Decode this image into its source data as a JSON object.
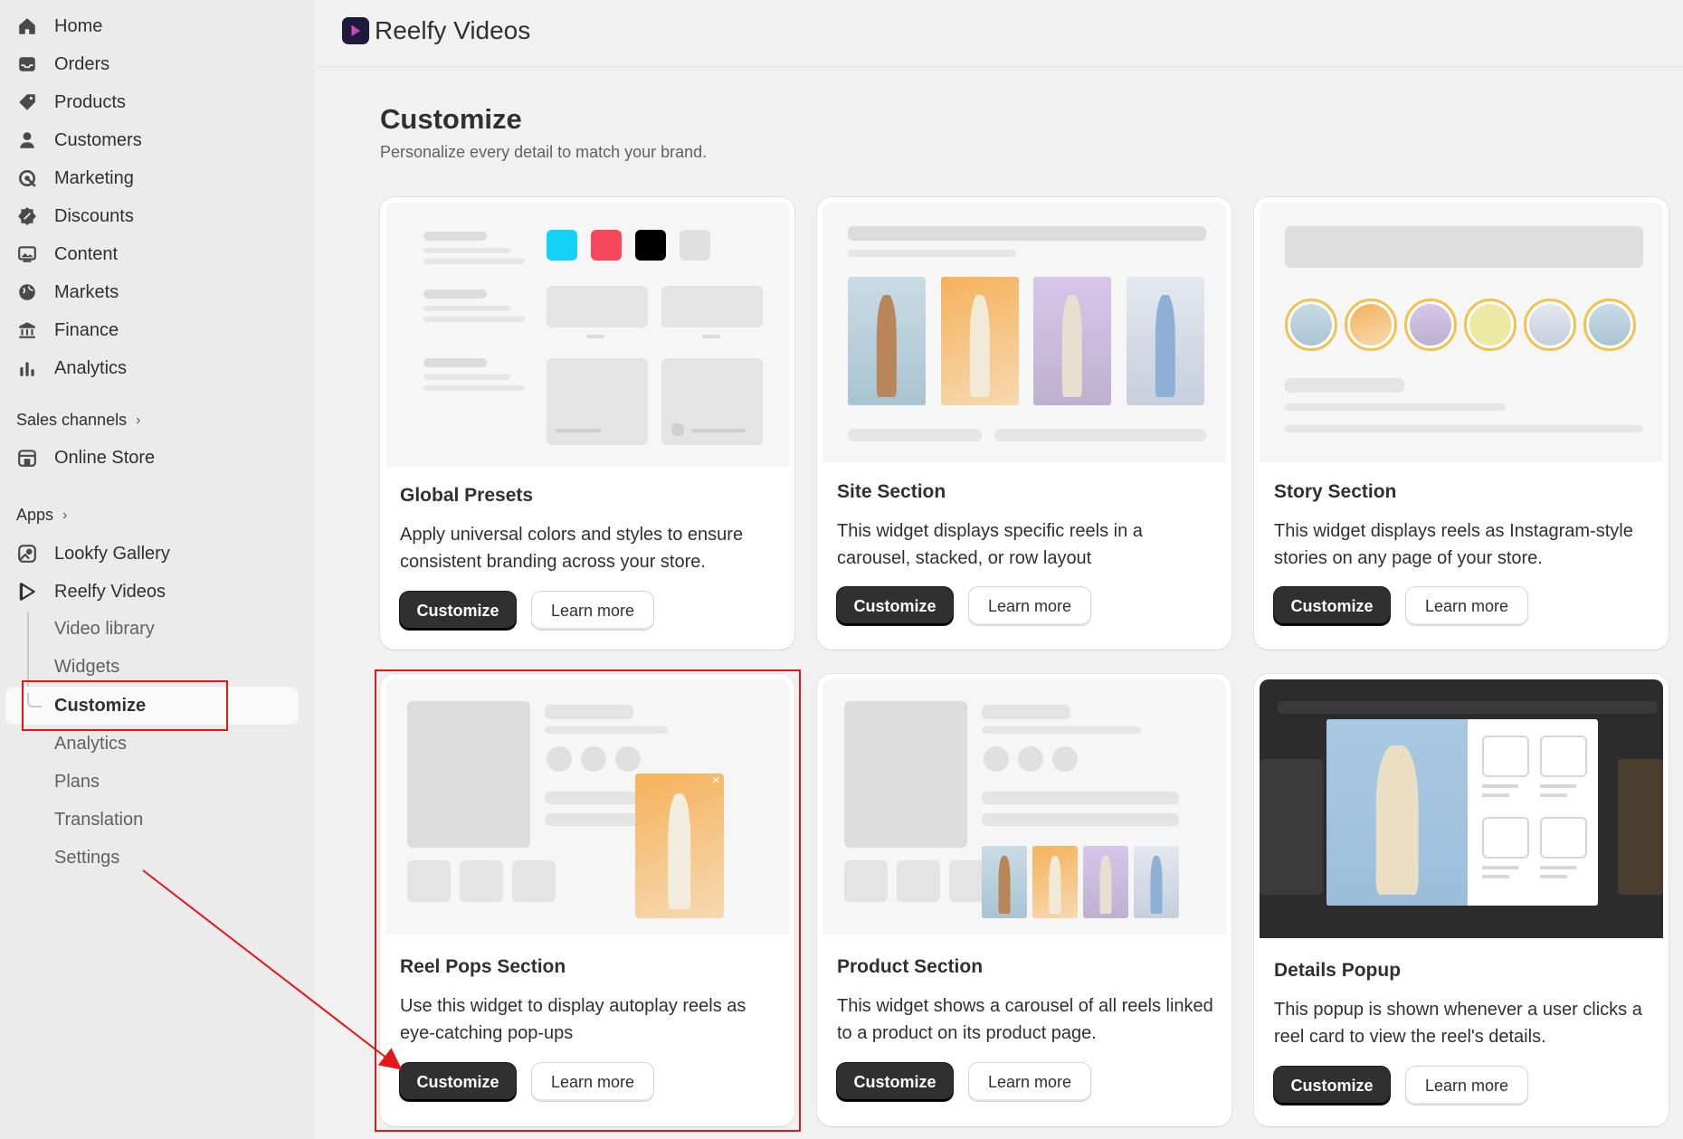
{
  "sidebar": {
    "nav": [
      {
        "label": "Home",
        "icon": "home-icon"
      },
      {
        "label": "Orders",
        "icon": "inbox-icon"
      },
      {
        "label": "Products",
        "icon": "tag-icon"
      },
      {
        "label": "Customers",
        "icon": "person-icon"
      },
      {
        "label": "Marketing",
        "icon": "target-icon"
      },
      {
        "label": "Discounts",
        "icon": "discount-icon"
      },
      {
        "label": "Content",
        "icon": "image-icon"
      },
      {
        "label": "Markets",
        "icon": "globe-icon"
      },
      {
        "label": "Finance",
        "icon": "bank-icon"
      },
      {
        "label": "Analytics",
        "icon": "chart-bars-icon"
      }
    ],
    "sales_channels_label": "Sales channels",
    "online_store_label": "Online Store",
    "apps_label": "Apps",
    "apps": [
      {
        "label": "Lookfy Gallery"
      },
      {
        "label": "Reelfy Videos"
      }
    ],
    "reelfy_sub": [
      "Video library",
      "Widgets",
      "Customize",
      "Analytics",
      "Plans",
      "Translation",
      "Settings"
    ]
  },
  "header": {
    "app_title": "Reelfy Videos"
  },
  "page": {
    "title": "Customize",
    "subtitle": "Personalize every detail to match your brand."
  },
  "cards": [
    {
      "title": "Global Presets",
      "desc": "Apply universal colors and styles to ensure consistent branding across your store.",
      "primary": "Customize",
      "secondary": "Learn more"
    },
    {
      "title": "Site Section",
      "desc": "This widget displays specific reels in a carousel, stacked, or row layout",
      "primary": "Customize",
      "secondary": "Learn more"
    },
    {
      "title": "Story Section",
      "desc": "This widget displays reels as Instagram-style stories on any page of your store.",
      "primary": "Customize",
      "secondary": "Learn more"
    },
    {
      "title": "Reel Pops Section",
      "desc": "Use this widget to display autoplay reels as eye-catching pop-ups",
      "primary": "Customize",
      "secondary": "Learn more"
    },
    {
      "title": "Product Section",
      "desc": "This widget shows a carousel of all reels linked to a product on its product page.",
      "primary": "Customize",
      "secondary": "Learn more"
    },
    {
      "title": "Details Popup",
      "desc": "This popup is shown whenever a user clicks a reel card to view the reel's details.",
      "primary": "Customize",
      "secondary": "Learn more"
    }
  ],
  "preset_colors": [
    "#14d2f5",
    "#f5485c",
    "#000000",
    "#e0e0e0"
  ],
  "annotation_color": "#e3161c"
}
